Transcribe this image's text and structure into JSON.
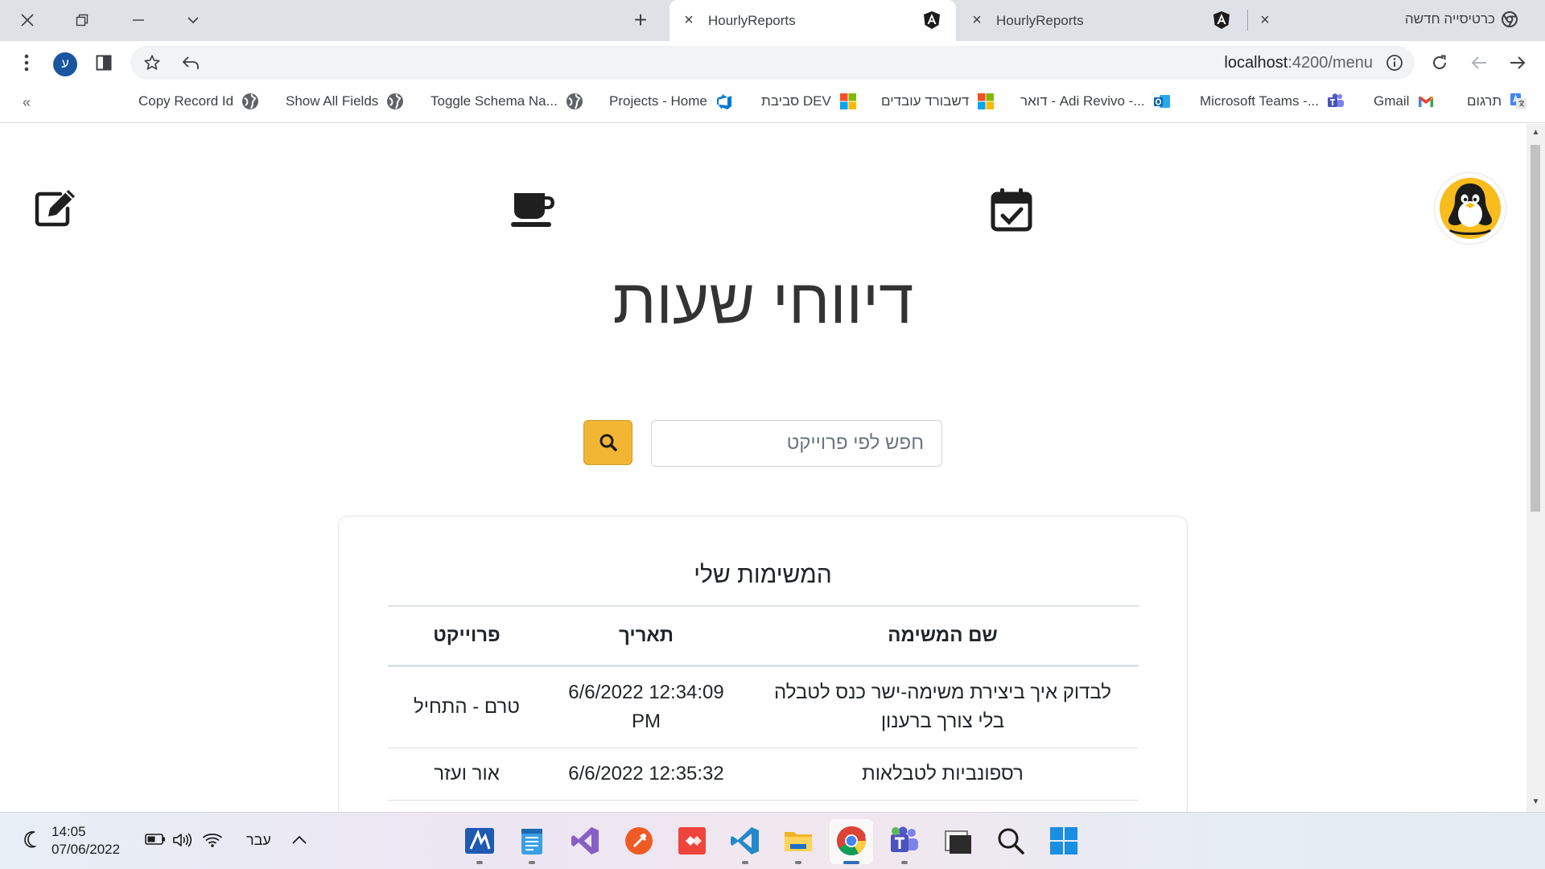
{
  "browser": {
    "tabs": [
      {
        "title": "HourlyReports",
        "active": true
      },
      {
        "title": "HourlyReports",
        "active": false
      }
    ],
    "new_tab_label": "כרטיסייה חדשה",
    "profile_initial": "ע",
    "url_host": "localhost",
    "url_path": ":4200/menu",
    "bookmarks": [
      {
        "label": "Copy Record Id",
        "icon": "globe-icon"
      },
      {
        "label": "Show All Fields",
        "icon": "globe-icon"
      },
      {
        "label": "Toggle Schema Na...",
        "icon": "globe-icon"
      },
      {
        "label": "Projects - Home",
        "icon": "azure-devops-icon"
      },
      {
        "label": "סביבת DEV",
        "icon": "microsoft-icon"
      },
      {
        "label": "דשבורד עובדים",
        "icon": "microsoft-icon"
      },
      {
        "label": "דואר - Adi Revivo -...",
        "icon": "outlook-icon"
      },
      {
        "label": "Microsoft Teams -...",
        "icon": "teams-icon"
      },
      {
        "label": "Gmail",
        "icon": "gmail-icon"
      },
      {
        "label": "תרגום",
        "icon": "translate-icon"
      }
    ]
  },
  "app": {
    "title": "דיווחי שעות",
    "nav_icons": [
      "edit-icon",
      "coffee-icon",
      "calendar-check-icon",
      "penguin-logo-icon"
    ],
    "search": {
      "placeholder": "חפש לפי פרוייקט",
      "value": ""
    },
    "tasks_card": {
      "title": "המשימות שלי",
      "columns": {
        "name": "שם המשימה",
        "date": "תאריך",
        "project": "פרוייקט"
      },
      "rows": [
        {
          "name": "לבדוק איך ביצירת משימה-ישר כנס לטבלה בלי צורך ברענון",
          "date": "6/6/2022 12:34:09 PM",
          "project": "טרם - התחיל"
        },
        {
          "name": "רספונביות לטבלאות",
          "date": "6/6/2022 12:35:32",
          "project": "אור ועזר"
        }
      ]
    },
    "accent_color": "#f2b634"
  },
  "taskbar": {
    "time": "14:05",
    "date": "07/06/2022",
    "language": "עבר",
    "apps": [
      "azure-data-studio-icon",
      "notepad-icon",
      "visual-studio-icon",
      "postman-icon",
      "anydesk-icon",
      "vscode-icon",
      "file-explorer-icon",
      "chrome-icon",
      "teams-icon",
      "terminal-icon",
      "search-icon",
      "windows-start-icon"
    ]
  }
}
